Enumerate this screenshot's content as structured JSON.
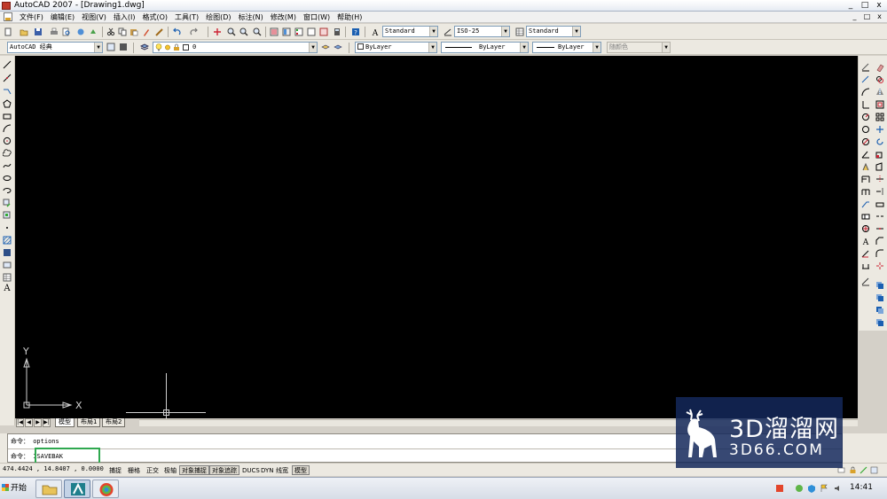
{
  "window": {
    "title": "AutoCAD 2007 - [Drawing1.dwg]",
    "controls": [
      "_",
      "□",
      "x"
    ],
    "doc_controls": [
      "_",
      "□",
      "x"
    ]
  },
  "menu": {
    "items": [
      "文件(F)",
      "编辑(E)",
      "视图(V)",
      "插入(I)",
      "格式(O)",
      "工具(T)",
      "绘图(D)",
      "标注(N)",
      "修改(M)",
      "窗口(W)",
      "帮助(H)"
    ]
  },
  "styles_toolbar": {
    "text_style": "Standard",
    "dim_style": "ISO-25",
    "table_style": "Standard"
  },
  "workspace_toolbar": {
    "workspace": "AutoCAD 经典",
    "layer": "0",
    "color": "ByLayer",
    "linetype": "ByLayer",
    "lineweight": "ByLayer",
    "plot_style": "随颜色"
  },
  "canvas": {
    "ucs_x": "X",
    "ucs_y": "Y"
  },
  "layout_tabs": {
    "nav": [
      "|◀",
      "◀",
      "▶",
      "▶|"
    ],
    "tabs": [
      "模型",
      "布局1",
      "布局2"
    ],
    "active": "模型"
  },
  "command": {
    "history": "命令： options",
    "current": "命令： ISAVEBAK"
  },
  "status": {
    "coordinates": "474.4424 , 14.8407 , 0.0000",
    "toggles": [
      "捕捉",
      "栅格",
      "正交",
      "极轴",
      "对象捕捉",
      "对象追踪",
      "DUCS",
      "DYN",
      "线宽",
      "模型"
    ],
    "on_toggles": [
      "对象捕捉",
      "对象追踪",
      "模型"
    ]
  },
  "taskbar": {
    "start_label": "开始",
    "clock": "14:41"
  },
  "watermark": {
    "brand": "3D溜溜网",
    "url": "3D66.COM"
  },
  "colors": {
    "canvas_bg": "#000000",
    "highlight_border": "#2fa84f",
    "watermark_bg": "#14285a"
  }
}
